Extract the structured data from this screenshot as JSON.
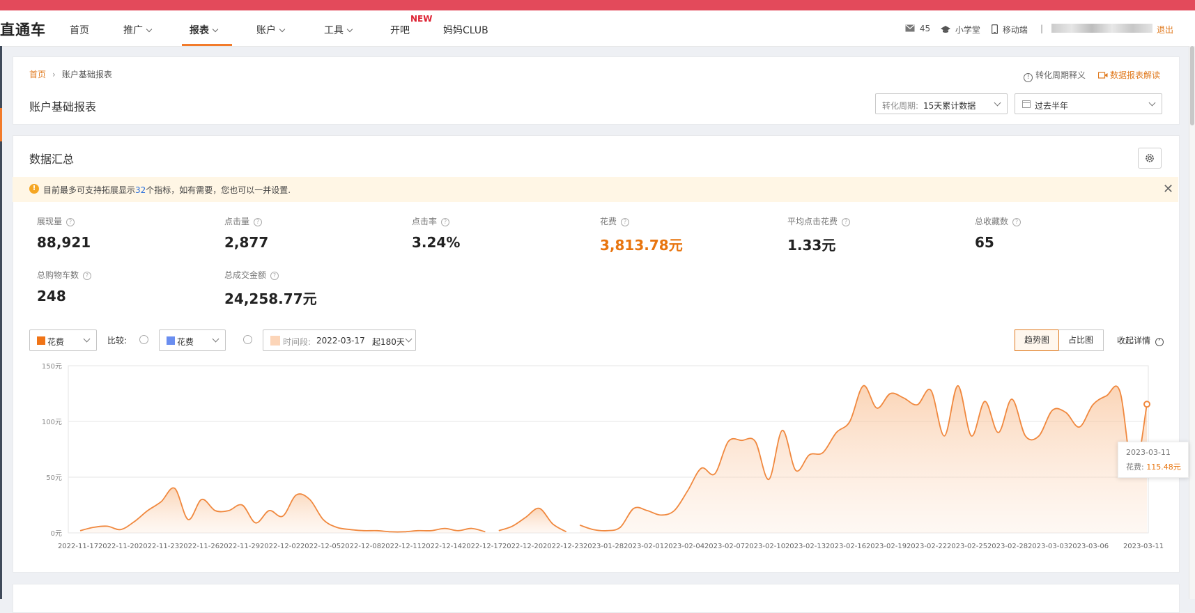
{
  "nav": {
    "logo": "直通车",
    "items": [
      {
        "label": "首页",
        "has_caret": false
      },
      {
        "label": "推广",
        "has_caret": true
      },
      {
        "label": "报表",
        "has_caret": true
      },
      {
        "label": "账户",
        "has_caret": true
      },
      {
        "label": "工具",
        "has_caret": true
      },
      {
        "label": "开吧",
        "has_caret": false
      },
      {
        "label": "妈妈CLUB",
        "has_caret": false
      }
    ],
    "active": "报表",
    "new_badge": "NEW",
    "messages_icon": "mail-icon",
    "messages_count": "45",
    "school_icon": "graduation-cap-icon",
    "school_label": "小学堂",
    "mobile_icon": "phone-icon",
    "mobile_label": "移动端",
    "divider": "|",
    "logout_label": "退出"
  },
  "breadcrumb": {
    "home": "首页",
    "separator": "›",
    "current": "账户基础报表"
  },
  "page_title": "账户基础报表",
  "help": {
    "conversion_cycle_label": "转化周期释义",
    "report_guide_label": "数据报表解读"
  },
  "filters": {
    "conversion_cycle": {
      "prefix": "转化周期:",
      "value": "15天累计数据"
    },
    "date_range": {
      "icon": "calendar-icon",
      "value": "过去半年"
    }
  },
  "summary": {
    "title": "数据汇总",
    "settings_icon": "gear-icon",
    "notice": {
      "before": "目前最多可支持拓展显示",
      "count": "32",
      "after": "个指标，如有需要，您也可以一并设置."
    },
    "metrics": [
      {
        "label": "展现量",
        "value": "88,921",
        "highlight": false
      },
      {
        "label": "点击量",
        "value": "2,877",
        "highlight": false
      },
      {
        "label": "点击率",
        "value": "3.24%",
        "highlight": false
      },
      {
        "label": "花费",
        "value": "3,813.78元",
        "highlight": true
      },
      {
        "label": "平均点击花费",
        "value": "1.33元",
        "highlight": false
      },
      {
        "label": "总收藏数",
        "value": "65",
        "highlight": false
      },
      {
        "label": "总购物车数",
        "value": "248",
        "highlight": false
      },
      {
        "label": "总成交金额",
        "value": "24,258.77元",
        "highlight": false
      }
    ]
  },
  "chart_controls": {
    "metric_select": {
      "label": "花费",
      "color": "#f07417"
    },
    "compare_label": "比较:",
    "compare_select": {
      "label": "花费",
      "color": "#6a8ef0"
    },
    "period_select": {
      "prefix": "时间段:",
      "date": "2022-03-17",
      "span": "起180天",
      "color": "#fcd5b8"
    },
    "view_tabs": [
      "趋势图",
      "占比图"
    ],
    "active_view": "趋势图",
    "collapse_label": "收起详情"
  },
  "chart_data": {
    "type": "area",
    "series": [
      {
        "name": "花费",
        "color": "#f0883e",
        "points": [
          [
            "2022-11-17",
            2
          ],
          [
            "2022-11-18",
            5
          ],
          [
            "2022-11-19",
            6
          ],
          [
            "2022-11-20",
            3
          ],
          [
            "2022-11-21",
            10
          ],
          [
            "2022-11-22",
            20
          ],
          [
            "2022-11-23",
            28
          ],
          [
            "2022-11-24",
            40
          ],
          [
            "2022-11-25",
            12
          ],
          [
            "2022-11-26",
            30
          ],
          [
            "2022-11-27",
            20
          ],
          [
            "2022-11-28",
            20
          ],
          [
            "2022-11-29",
            25
          ],
          [
            "2022-11-30",
            9
          ],
          [
            "2022-12-01",
            20
          ],
          [
            "2022-12-02",
            15
          ],
          [
            "2022-12-03",
            34
          ],
          [
            "2022-12-04",
            30
          ],
          [
            "2022-12-05",
            12
          ],
          [
            "2022-12-06",
            5
          ],
          [
            "2022-12-07",
            3
          ],
          [
            "2022-12-08",
            2
          ],
          [
            "2022-12-09",
            2
          ],
          [
            "2022-12-10",
            1
          ],
          [
            "2022-12-11",
            1
          ],
          [
            "2022-12-12",
            2
          ],
          [
            "2022-12-13",
            2
          ],
          [
            "2022-12-14",
            4
          ],
          [
            "2022-12-15",
            2
          ],
          [
            "2022-12-16",
            4
          ],
          [
            "2022-12-17",
            1
          ],
          [
            null,
            null
          ],
          [
            "2022-12-18",
            2
          ],
          [
            "2022-12-19",
            6
          ],
          [
            "2022-12-20",
            14
          ],
          [
            "2022-12-21",
            22
          ],
          [
            "2022-12-22",
            8
          ],
          [
            "2022-12-23",
            1
          ],
          [
            null,
            null
          ],
          [
            "2023-01-28",
            7
          ],
          [
            "2023-01-29",
            3
          ],
          [
            "2023-01-30",
            2
          ],
          [
            "2023-01-31",
            5
          ],
          [
            "2023-02-01",
            22
          ],
          [
            "2023-02-02",
            20
          ],
          [
            "2023-02-03",
            16
          ],
          [
            "2023-02-04",
            20
          ],
          [
            "2023-02-05",
            38
          ],
          [
            "2023-02-06",
            58
          ],
          [
            "2023-02-07",
            53
          ],
          [
            "2023-02-08",
            82
          ],
          [
            "2023-02-09",
            83
          ],
          [
            "2023-02-10",
            82
          ],
          [
            "2023-02-11",
            48
          ],
          [
            "2023-02-12",
            92
          ],
          [
            "2023-02-13",
            56
          ],
          [
            "2023-02-14",
            70
          ],
          [
            "2023-02-15",
            72
          ],
          [
            "2023-02-16",
            90
          ],
          [
            "2023-02-17",
            100
          ],
          [
            "2023-02-18",
            132
          ],
          [
            "2023-02-19",
            112
          ],
          [
            "2023-02-20",
            125
          ],
          [
            "2023-02-21",
            121
          ],
          [
            "2023-02-22",
            115
          ],
          [
            "2023-02-23",
            128
          ],
          [
            "2023-02-24",
            87
          ],
          [
            "2023-02-25",
            132
          ],
          [
            "2023-02-26",
            87
          ],
          [
            "2023-02-27",
            118
          ],
          [
            "2023-02-28",
            90
          ],
          [
            "2023-03-01",
            120
          ],
          [
            "2023-03-02",
            87
          ],
          [
            "2023-03-03",
            87
          ],
          [
            "2023-03-04",
            110
          ],
          [
            "2023-03-05",
            108
          ],
          [
            "2023-03-06",
            95
          ],
          [
            "2023-03-07",
            115
          ],
          [
            "2023-03-08",
            123
          ],
          [
            "2023-03-09",
            127
          ],
          [
            "2023-03-10",
            52
          ],
          [
            "2023-03-11",
            115.48
          ]
        ]
      }
    ],
    "x_tick_labels": [
      "2022-11-17",
      "2022-11-20",
      "2022-11-23",
      "2022-11-26",
      "2022-11-29",
      "2022-12-02",
      "2022-12-05",
      "2022-12-08",
      "2022-12-11",
      "2022-12-14",
      "2022-12-17",
      "2022-12-20",
      "2022-12-23",
      "2023-01-28",
      "2023-02-01",
      "2023-02-04",
      "2023-02-07",
      "2023-02-10",
      "2023-02-13",
      "2023-02-16",
      "2023-02-19",
      "2023-02-22",
      "2023-02-25",
      "2023-02-28",
      "2023-03-03",
      "2023-03-06",
      "2023-03-11"
    ],
    "y_ticks": [
      "0元",
      "50元",
      "100元",
      "150元"
    ],
    "y_values": [
      0,
      50,
      100,
      150
    ],
    "ylim": [
      0,
      150
    ],
    "grid": true,
    "tooltip": {
      "date": "2023-03-11",
      "label": "花费:",
      "value": "115.48元"
    }
  }
}
